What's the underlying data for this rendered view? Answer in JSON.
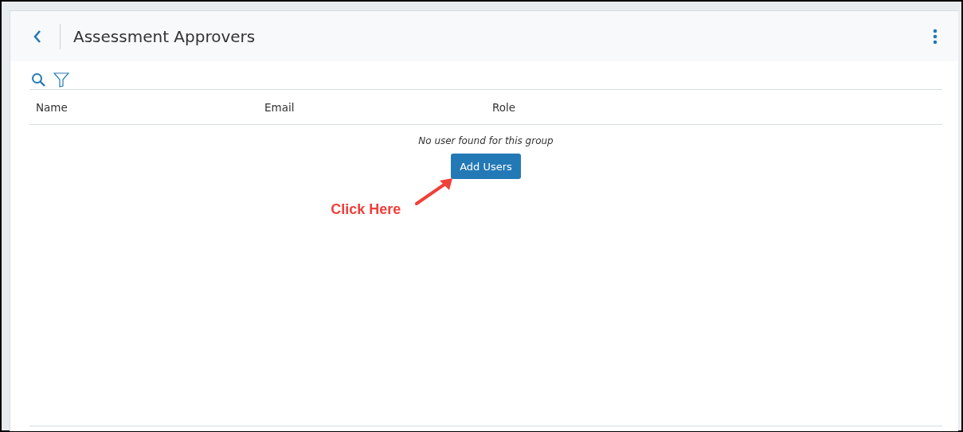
{
  "header": {
    "title": "Assessment Approvers"
  },
  "table": {
    "columns": [
      "Name",
      "Email",
      "Role"
    ],
    "empty_message": "No user found for this group",
    "add_button": "Add Users"
  },
  "annotation": {
    "text": "Click Here"
  }
}
